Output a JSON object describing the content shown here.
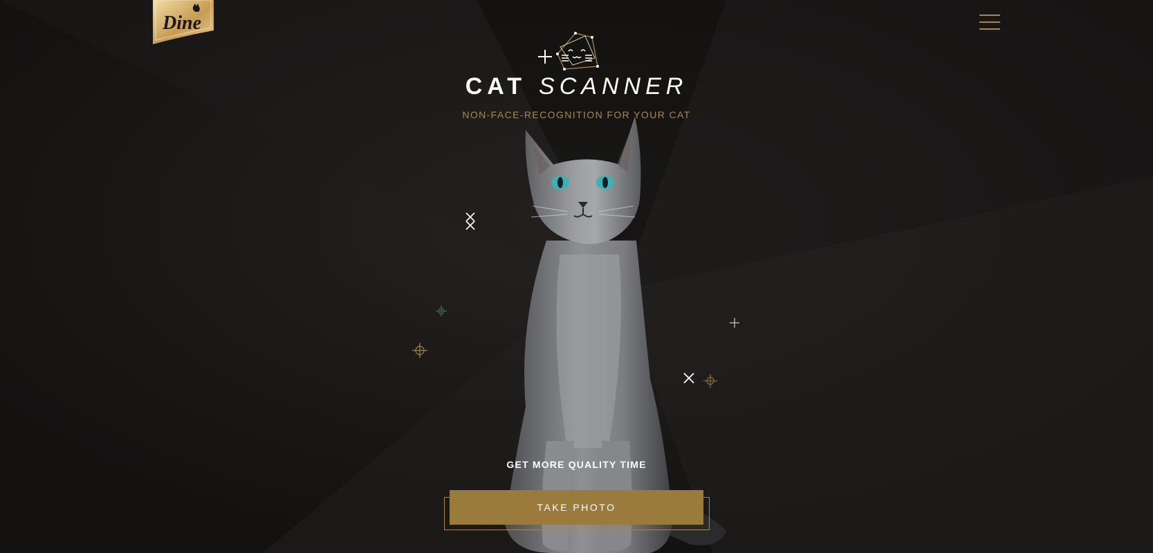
{
  "brand": {
    "logo_text": "Dine",
    "logo_icon": "cat-silhouette-icon"
  },
  "header": {
    "menu_icon": "hamburger-menu-icon"
  },
  "hero": {
    "icon": "cat-scanner-icon",
    "title_word1": "CAT",
    "title_word2": "SCANNER",
    "subtitle": "NON-FACE-RECOGNITION FOR YOUR CAT",
    "image": "grey-cat-photo"
  },
  "cta": {
    "label": "GET MORE QUALITY TIME",
    "button_label": "TAKE PHOTO"
  },
  "colors": {
    "background": "#1c1a19",
    "accent_gold": "#a9874a",
    "button_gold": "#9a7b3c",
    "text_white": "#ffffff"
  }
}
